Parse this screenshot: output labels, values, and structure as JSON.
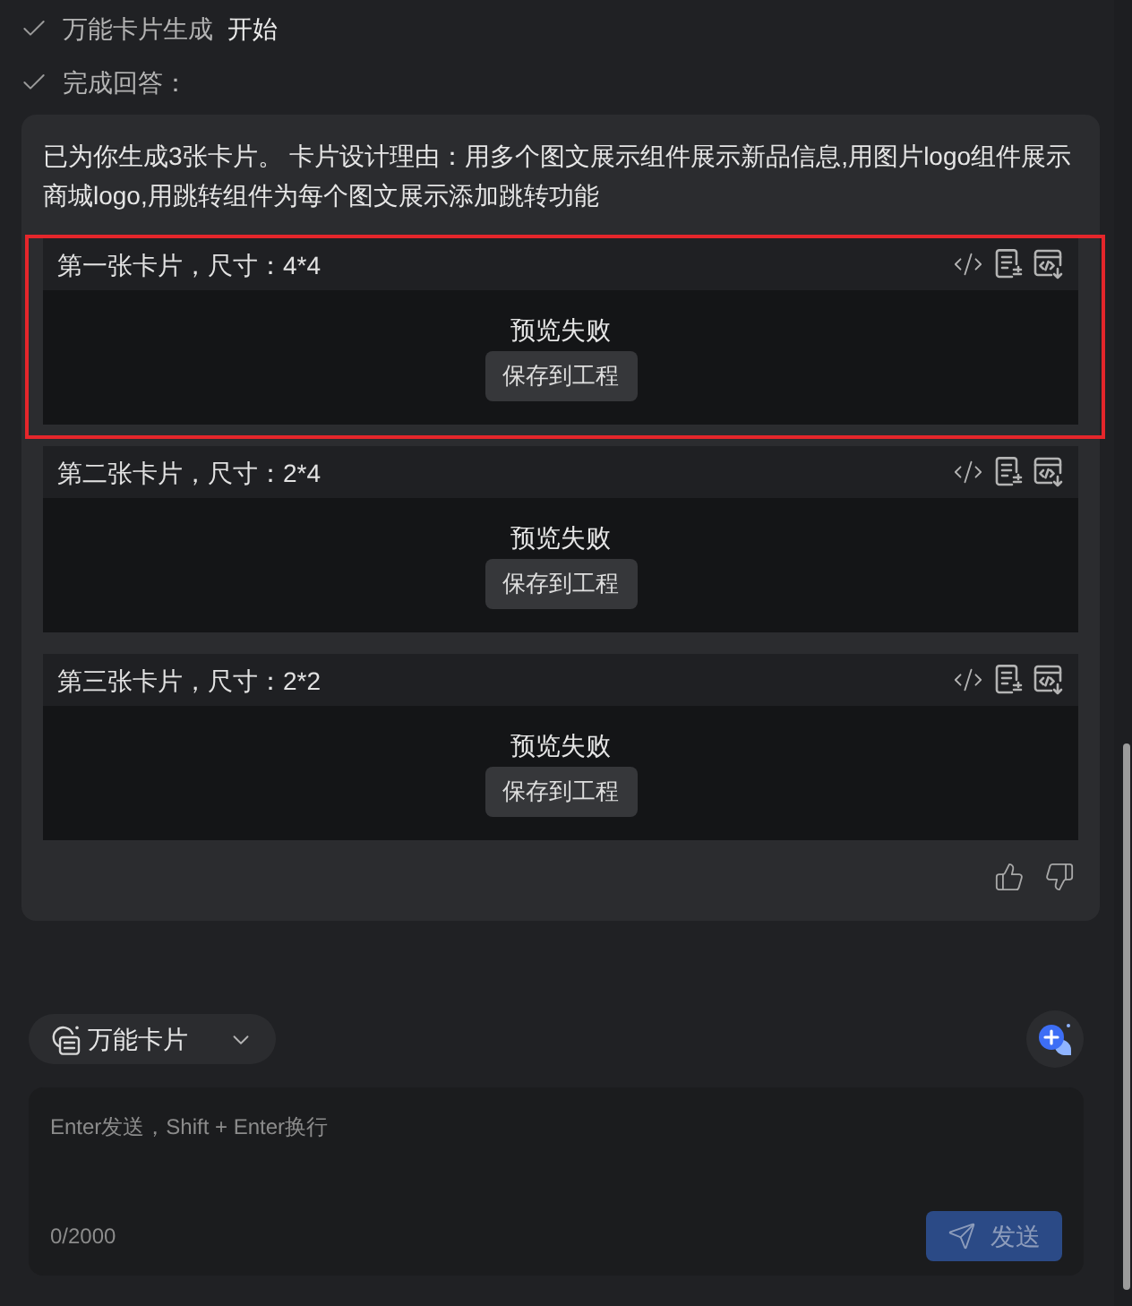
{
  "steps": [
    {
      "label": "万能卡片生成",
      "status": "开始",
      "done": true
    },
    {
      "label": "完成回答：",
      "done": true
    }
  ],
  "answer": {
    "text": "已为你生成3张卡片。 卡片设计理由：用多个图文展示组件展示新品信息,用图片logo组件展示商城logo,用跳转组件为每个图文展示添加跳转功能",
    "cards": [
      {
        "title": "第一张卡片，尺寸：4*4",
        "selected": true,
        "message": "预览失败",
        "button": "保存到工程"
      },
      {
        "title": "第二张卡片，尺寸：2*4",
        "selected": false,
        "message": "预览失败",
        "button": "保存到工程"
      },
      {
        "title": "第三张卡片，尺寸：2*2",
        "selected": false,
        "message": "预览失败",
        "button": "保存到工程"
      }
    ]
  },
  "composer": {
    "mode": "万能卡片",
    "placeholder": "Enter发送，Shift + Enter换行",
    "counter": "0/2000",
    "send_button": {
      "label": "发送",
      "disabled": true
    }
  }
}
